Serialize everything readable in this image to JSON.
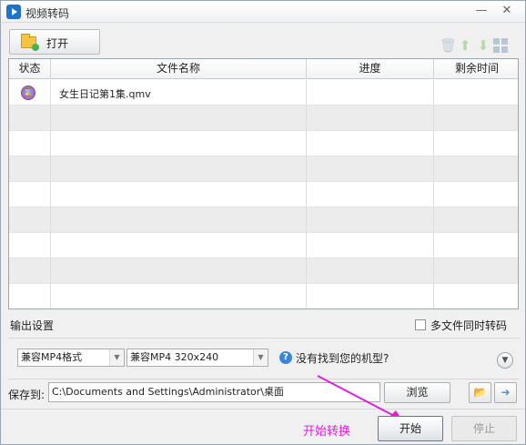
{
  "window": {
    "title": "视频转码",
    "minimize": "—",
    "close": "✕"
  },
  "toolbar": {
    "open_label": "打开",
    "icons": [
      "folder-add-icon",
      "trash-icon",
      "arrow-up-icon",
      "arrow-down-icon",
      "grid-icon"
    ]
  },
  "table": {
    "columns": [
      "状态",
      "文件名称",
      "进度",
      "剩余时间"
    ],
    "rows": [
      {
        "status_icon": "hourglass-icon",
        "name": "女生日记第1集.qmv",
        "progress": "",
        "remaining": ""
      }
    ],
    "empty_rows": 8
  },
  "output": {
    "label": "输出设置",
    "multi_file_label": "多文件同时转码",
    "multi_file_checked": false,
    "format_value": "兼容MP4格式",
    "resolution_value": "兼容MP4 320x240",
    "help_text": "没有找到您的机型?"
  },
  "save": {
    "label": "保存到:",
    "path": "C:\\Documents and Settings\\Administrator\\桌面",
    "browse_label": "浏览"
  },
  "bottom": {
    "annotation": "开始转换",
    "start_label": "开始",
    "stop_label": "停止"
  },
  "colors": {
    "accent": "#1f74c9",
    "annotation": "#e020d8",
    "hourglass": "#8e5aae"
  }
}
